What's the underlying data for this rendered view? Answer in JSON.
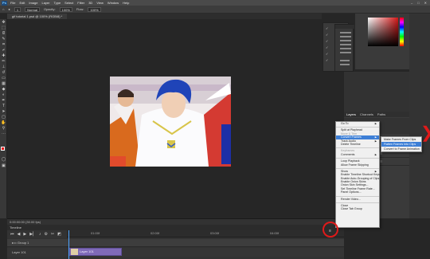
{
  "menubar": {
    "logo": "Ps",
    "items": [
      "File",
      "Edit",
      "Image",
      "Layer",
      "Type",
      "Select",
      "Filter",
      "3D",
      "View",
      "Window",
      "Help"
    ],
    "window_controls": [
      "–",
      "□",
      "✕"
    ]
  },
  "options": {
    "brush_size": "1",
    "mode": "Normal",
    "opacity_label": "Opacity:",
    "opacity": "100%",
    "flow_label": "Flow:",
    "flow": "100%"
  },
  "document": {
    "tab_title": "gif tutorial 1.psd @ 100% (RGB/8) *"
  },
  "timeline": {
    "panel_title": "Timeline",
    "status": "0:00:00:00 (30.00 fps)",
    "ruler_ticks": [
      "01:00f",
      "02:00f",
      "03:00f",
      "04:00f"
    ],
    "tracks": [
      {
        "label": "Group 1"
      },
      {
        "label": "Layer 101"
      }
    ],
    "clip_label": "Layer 101",
    "menu_icon": "≡"
  },
  "layers": {
    "tabs": [
      "Layers",
      "Channels",
      "Paths"
    ]
  },
  "context_menu": {
    "items": [
      {
        "label": "Go To",
        "type": "sub"
      },
      {
        "label": "",
        "type": "sep"
      },
      {
        "label": "Split at Playhead",
        "type": "normal"
      },
      {
        "label": "Move & Trim",
        "type": "disabled"
      },
      {
        "label": "Convert Frames",
        "type": "sub-hl"
      },
      {
        "label": "Track Audio",
        "type": "sub"
      },
      {
        "label": "Delete Timeline",
        "type": "normal"
      },
      {
        "label": "",
        "type": "sep"
      },
      {
        "label": "Keyframes",
        "type": "disabled"
      },
      {
        "label": "Comments",
        "type": "sub"
      },
      {
        "label": "",
        "type": "sep"
      },
      {
        "label": "Loop Playback",
        "type": "normal"
      },
      {
        "label": "Allow Frame Skipping",
        "type": "normal"
      },
      {
        "label": "",
        "type": "sep"
      },
      {
        "label": "Show",
        "type": "sub"
      },
      {
        "label": "Enable Timeline Shortcut Keys",
        "type": "normal"
      },
      {
        "label": "Enable Auto-Grouping of Clips",
        "type": "normal"
      },
      {
        "label": "Enable Onion Skins",
        "type": "normal"
      },
      {
        "label": "Onion Skin Settings...",
        "type": "normal"
      },
      {
        "label": "Set Timeline Frame Rate...",
        "type": "normal"
      },
      {
        "label": "Panel Options...",
        "type": "normal"
      },
      {
        "label": "",
        "type": "sep"
      },
      {
        "label": "Render Video...",
        "type": "normal"
      },
      {
        "label": "",
        "type": "sep"
      },
      {
        "label": "Close",
        "type": "normal"
      },
      {
        "label": "Close Tab Group",
        "type": "normal"
      }
    ]
  },
  "submenu": {
    "items": [
      {
        "label": "Make Frames From Clips",
        "highlight": false
      },
      {
        "label": "Flatten Frames Into Clips",
        "highlight": true
      },
      {
        "label": "Convert to Frame Animation",
        "highlight": false
      }
    ]
  },
  "tools": [
    "move-icon",
    "marquee-icon",
    "lasso-icon",
    "quick-select-icon",
    "crop-icon",
    "eyedropper-icon",
    "healing-icon",
    "brush-icon",
    "stamp-icon",
    "history-brush-icon",
    "eraser-icon",
    "gradient-icon",
    "blur-icon",
    "dodge-icon",
    "pen-icon",
    "type-icon",
    "path-select-icon",
    "shape-icon",
    "hand-icon",
    "zoom-icon"
  ],
  "colors": {
    "foreground": "#e01010",
    "background": "#ffffff",
    "clip": "#7f6ab8",
    "highlight": "#3d7fd6",
    "annotation": "#e01a1a"
  }
}
